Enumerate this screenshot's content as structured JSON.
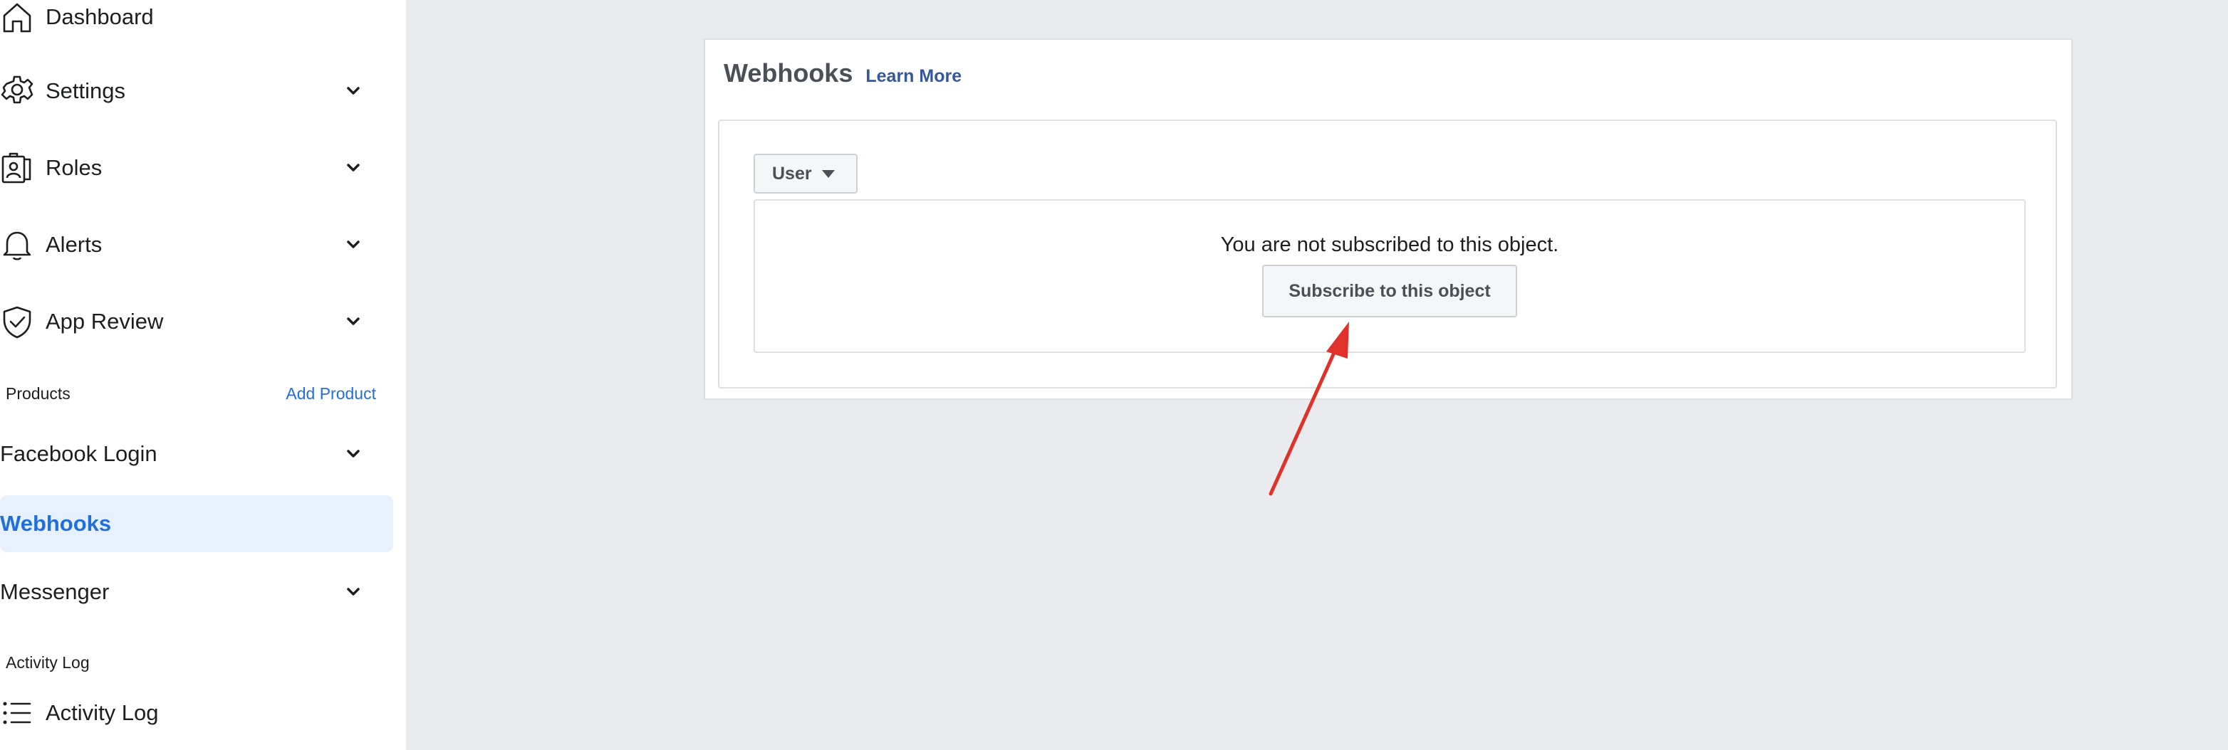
{
  "sidebar": {
    "items": [
      {
        "label": "Dashboard",
        "icon": "home-icon"
      },
      {
        "label": "Settings",
        "icon": "gear-icon"
      },
      {
        "label": "Roles",
        "icon": "id-badge-icon"
      },
      {
        "label": "Alerts",
        "icon": "bell-icon"
      },
      {
        "label": "App Review",
        "icon": "shield-check-icon"
      }
    ],
    "products": {
      "heading": "Products",
      "add_link": "Add Product",
      "items": [
        {
          "label": "Facebook Login"
        },
        {
          "label": "Webhooks",
          "active": true
        },
        {
          "label": "Messenger"
        }
      ]
    },
    "activity": {
      "heading": "Activity Log",
      "item": {
        "label": "Activity Log",
        "icon": "list-icon"
      }
    }
  },
  "main": {
    "title": "Webhooks",
    "learn_more": "Learn More",
    "object_select": "User",
    "status_message": "You are not subscribed to this object.",
    "subscribe_button": "Subscribe to this object"
  },
  "colors": {
    "active_text": "#216fdb",
    "active_bg": "#e7f0fd",
    "link": "#365899",
    "annotation_arrow": "#e0312a",
    "page_bg": "#e9ebee"
  }
}
